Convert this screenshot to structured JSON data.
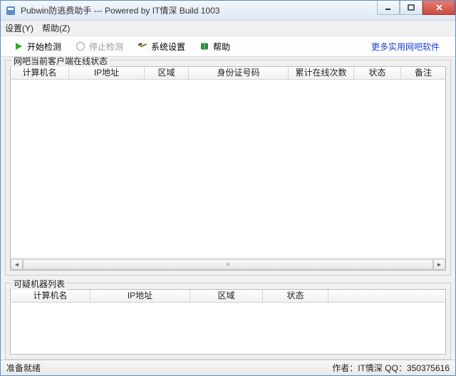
{
  "window": {
    "title": "Pubwin防逃费助手  ---  Powered by IT情深  Build 1003"
  },
  "menu": {
    "settings": "设置(Y)",
    "help": "帮助(Z)"
  },
  "toolbar": {
    "start": "开始检测",
    "stop": "停止检测",
    "settings": "系统设置",
    "help": "帮助",
    "more_link": "更多实用网吧软件"
  },
  "group1": {
    "title": "网吧当前客户端在线状态",
    "columns": [
      "计算机名",
      "IP地址",
      "区域",
      "身份证号码",
      "累计在线次数",
      "状态",
      "备注"
    ],
    "rows": []
  },
  "group2": {
    "title": "可疑机器列表",
    "columns": [
      "计算机名",
      "IP地址",
      "区域",
      "状态",
      ""
    ],
    "rows": []
  },
  "statusbar": {
    "ready": "准备就绪",
    "author": "作者：IT情深 QQ：350375616"
  }
}
